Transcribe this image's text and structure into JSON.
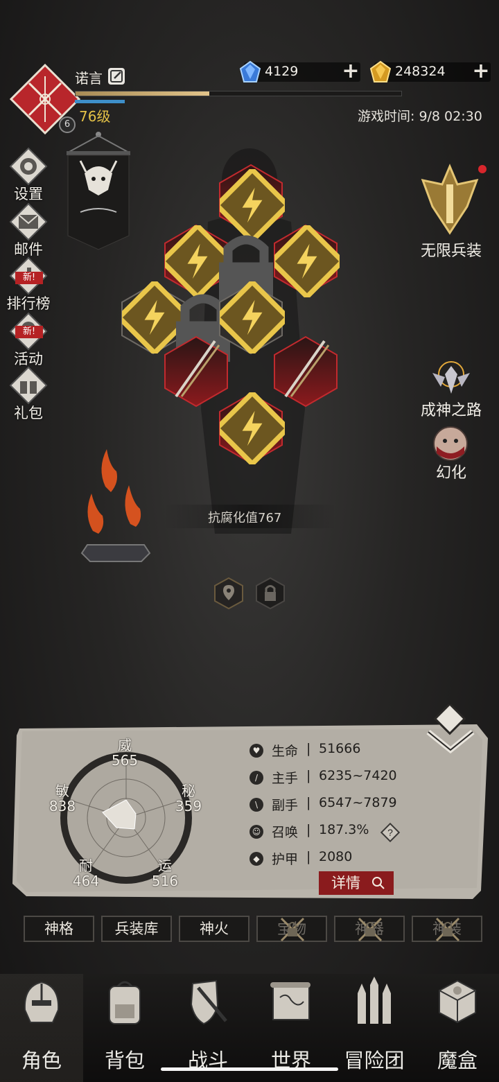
{
  "player": {
    "name": "诺言",
    "level_text": "76级",
    "rank_badge": "6",
    "xp_fraction": 0.41
  },
  "currency": {
    "gems": "4129",
    "gold": "248324"
  },
  "game_time": "游戏时间: 9/8 02:30",
  "side_menu": [
    {
      "label": "设置",
      "icon": "gear-icon"
    },
    {
      "label": "邮件",
      "icon": "mail-icon"
    },
    {
      "label": "排行榜",
      "icon": "trophy-icon",
      "badge": "新!"
    },
    {
      "label": "活动",
      "icon": "activity-icon",
      "badge": "新!"
    },
    {
      "label": "礼包",
      "icon": "gift-icon"
    }
  ],
  "right_menu": {
    "infinite_weapon": "无限兵装",
    "path_to_god": "成神之路",
    "transform": "幻化"
  },
  "equipment_slots": [
    "scarf",
    "helmet",
    "ring",
    "belt",
    "armor",
    "weapon-left",
    "weapon-right",
    "boots"
  ],
  "corruption_text": "抗腐化值767",
  "attributes": {
    "wei": {
      "label": "威",
      "value": "565"
    },
    "mi": {
      "label": "秘",
      "value": "359"
    },
    "yun": {
      "label": "运",
      "value": "516"
    },
    "nai": {
      "label": "耐",
      "value": "464"
    },
    "min": {
      "label": "敏",
      "value": "838"
    }
  },
  "stats": [
    {
      "name": "生命",
      "sep": "|",
      "value": "51666",
      "icon": "heart-icon"
    },
    {
      "name": "主手",
      "sep": "|",
      "value": "6235~7420",
      "icon": "sword-icon"
    },
    {
      "name": "副手",
      "sep": "|",
      "value": "6547~7879",
      "icon": "offhand-icon"
    },
    {
      "name": "召唤",
      "sep": "|",
      "value": "187.3%",
      "icon": "summon-icon"
    },
    {
      "name": "护甲",
      "sep": "|",
      "value": "2080",
      "icon": "armor-icon"
    }
  ],
  "detail_button": "详情",
  "sub_tabs": [
    {
      "label": "神格",
      "locked": false
    },
    {
      "label": "兵装库",
      "locked": false
    },
    {
      "label": "神火",
      "locked": false
    },
    {
      "label": "宝物",
      "locked": true
    },
    {
      "label": "神器",
      "locked": true
    },
    {
      "label": "神装",
      "locked": true
    }
  ],
  "bottom_nav": [
    {
      "label": "角色",
      "icon": "helmet-icon"
    },
    {
      "label": "背包",
      "icon": "backpack-icon"
    },
    {
      "label": "战斗",
      "icon": "shield-sword-icon"
    },
    {
      "label": "世界",
      "icon": "map-scroll-icon"
    },
    {
      "label": "冒险团",
      "icon": "castle-icon"
    },
    {
      "label": "魔盒",
      "icon": "cube-icon"
    }
  ]
}
